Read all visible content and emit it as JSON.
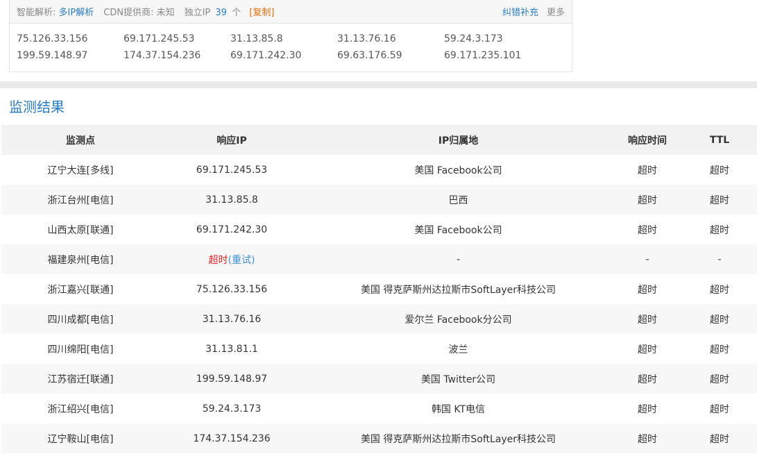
{
  "header": {
    "smart_parse_label": "智能解析:",
    "smart_parse_link": "多IP解析",
    "cdn_label": "CDN提供商:",
    "cdn_value": "未知",
    "unique_ip_label": "独立IP",
    "unique_ip_count": "39",
    "unique_ip_unit": "个",
    "copy_label": "[复制]",
    "fix_label": "纠错补充",
    "more_label": "更多"
  },
  "ip_list": [
    "75.126.33.156",
    "69.171.245.53",
    "31.13.85.8",
    "31.13.76.16",
    "59.24.3.173",
    "199.59.148.97",
    "174.37.154.236",
    "69.171.242.30",
    "69.63.176.59",
    "69.171.235.101"
  ],
  "results": {
    "title": "监测结果",
    "columns": [
      "监测点",
      "响应IP",
      "IP归属地",
      "响应时间",
      "TTL"
    ],
    "rows": [
      {
        "node": "辽宁大连[多线]",
        "ip": "69.171.245.53",
        "location": "美国 Facebook公司",
        "time": "超时",
        "ttl": "超时"
      },
      {
        "node": "浙江台州[电信]",
        "ip": "31.13.85.8",
        "location": "巴西",
        "time": "超时",
        "ttl": "超时"
      },
      {
        "node": "山西太原[联通]",
        "ip": "69.171.242.30",
        "location": "美国 Facebook公司",
        "time": "超时",
        "ttl": "超时"
      },
      {
        "node": "福建泉州[电信]",
        "ip": "",
        "ip_timeout": "超时",
        "ip_retry": "(重试)",
        "location": "-",
        "time": "-",
        "ttl": "-"
      },
      {
        "node": "浙江嘉兴[联通]",
        "ip": "75.126.33.156",
        "location": "美国 得克萨斯州达拉斯市SoftLayer科技公司",
        "time": "超时",
        "ttl": "超时"
      },
      {
        "node": "四川成都[电信]",
        "ip": "31.13.76.16",
        "location": "爱尔兰 Facebook分公司",
        "time": "超时",
        "ttl": "超时"
      },
      {
        "node": "四川绵阳[电信]",
        "ip": "31.13.81.1",
        "location": "波兰",
        "time": "超时",
        "ttl": "超时"
      },
      {
        "node": "江苏宿迁[联通]",
        "ip": "199.59.148.97",
        "location": "美国 Twitter公司",
        "time": "超时",
        "ttl": "超时"
      },
      {
        "node": "浙江绍兴[电信]",
        "ip": "59.24.3.173",
        "location": "韩国 KT电信",
        "time": "超时",
        "ttl": "超时"
      },
      {
        "node": "辽宁鞍山[电信]",
        "ip": "174.37.154.236",
        "location": "美国 得克萨斯州达拉斯市SoftLayer科技公司",
        "time": "超时",
        "ttl": "超时"
      }
    ]
  },
  "colors": {
    "link_blue": "#2a7dc0",
    "ip_blue": "#3e8fce",
    "timeout_red": "#e4262b",
    "copy_orange": "#e36c09",
    "header_bg": "#f2f2f2",
    "band_gray": "#e9e9e9"
  }
}
